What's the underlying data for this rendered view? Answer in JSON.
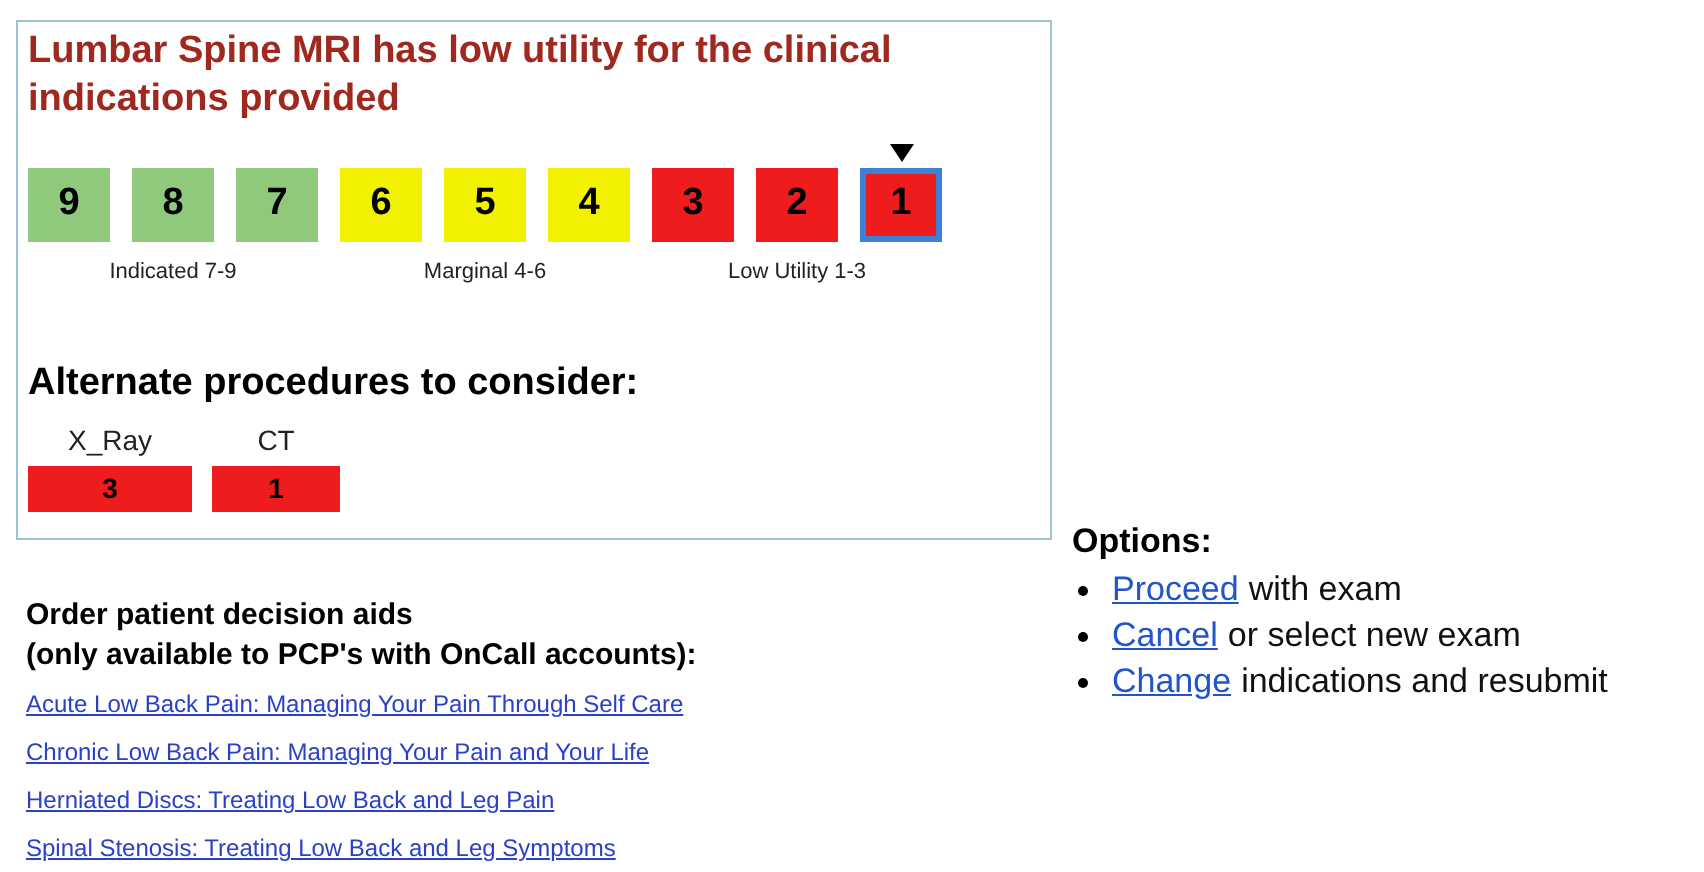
{
  "result": {
    "title": "Lumbar Spine MRI has low utility for the clinical indications provided",
    "groups": [
      {
        "label": "Indicated 7-9",
        "scores": [
          {
            "value": "9",
            "color": "#8fca7c",
            "selected": false
          },
          {
            "value": "8",
            "color": "#8fca7c",
            "selected": false
          },
          {
            "value": "7",
            "color": "#8fca7c",
            "selected": false
          }
        ]
      },
      {
        "label": "Marginal 4-6",
        "scores": [
          {
            "value": "6",
            "color": "#f2f200",
            "selected": false
          },
          {
            "value": "5",
            "color": "#f2f200",
            "selected": false
          },
          {
            "value": "4",
            "color": "#f2f200",
            "selected": false
          }
        ]
      },
      {
        "label": "Low Utility 1-3",
        "scores": [
          {
            "value": "3",
            "color": "#ee1c1c",
            "selected": false
          },
          {
            "value": "2",
            "color": "#ee1c1c",
            "selected": false
          },
          {
            "value": "1",
            "color": "#ee1c1c",
            "selected": true
          }
        ]
      }
    ],
    "alternates_heading": "Alternate procedures to consider:",
    "alternates": [
      {
        "name": "X_Ray",
        "score": "3",
        "color": "#ee1c1c"
      },
      {
        "name": "CT",
        "score": "1",
        "color": "#ee1c1c"
      }
    ]
  },
  "decision_aids": {
    "heading": "Order patient decision aids",
    "subheading": "(only available to PCP's with OnCall accounts):",
    "links": [
      "Acute Low Back Pain: Managing Your Pain Through Self Care",
      "Chronic Low Back Pain: Managing Your Pain and Your Life",
      "Herniated Discs: Treating Low Back and Leg Pain",
      "Spinal Stenosis: Treating Low Back and Leg Symptoms"
    ]
  },
  "options": {
    "heading": "Options:",
    "items": [
      {
        "link": "Proceed",
        "text": "with exam"
      },
      {
        "link": "Cancel",
        "text": "or select new exam"
      },
      {
        "link": "Change",
        "text": "indications and resubmit"
      }
    ]
  }
}
